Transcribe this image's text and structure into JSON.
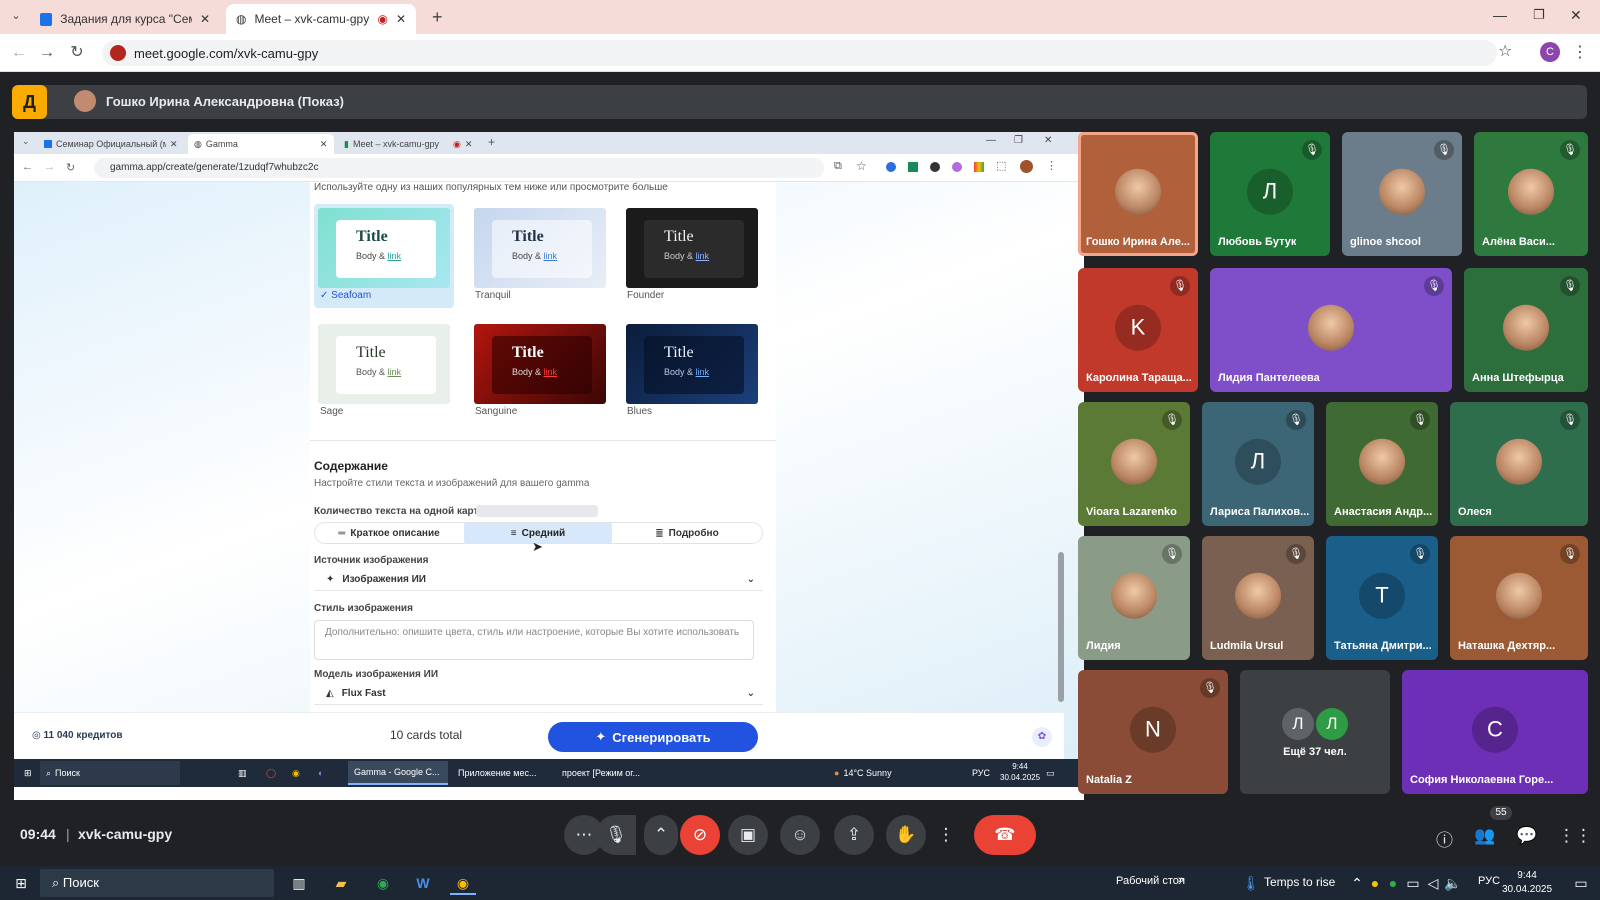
{
  "browser": {
    "tabs": [
      {
        "label": "Задания для курса \"Семинар"
      },
      {
        "label": "Meet – xvk-camu-gpy"
      }
    ],
    "url": "meet.google.com/xvk-camu-gpy"
  },
  "meet": {
    "presenter": "Гошко Ирина Александровна (Показ)",
    "logo": "Д",
    "time": "09:44",
    "code": "xvk-camu-gpy",
    "people_count": "55",
    "participants": [
      {
        "name": "Гошко Ирина Але...",
        "initial": "",
        "color": "#b0603a"
      },
      {
        "name": "Любовь Бутук",
        "initial": "Л",
        "color": "#1f7a39"
      },
      {
        "name": "glinoe shcool",
        "initial": "",
        "color": "#6b7d8a"
      },
      {
        "name": "Алёна Васи...",
        "initial": "",
        "color": "#2e7a3e"
      },
      {
        "name": "Каролина Тараща...",
        "initial": "K",
        "color": "#c0392b"
      },
      {
        "name": "Лидия Пантелеева",
        "initial": "",
        "color": "#7e4fc9"
      },
      {
        "name": "Анна Штефырца",
        "initial": "",
        "color": "#2c6e3c"
      },
      {
        "name": "Vioara Lazarenko",
        "initial": "",
        "color": "#5b7a36"
      },
      {
        "name": "Лариса Палихов...",
        "initial": "Л",
        "color": "#3c6575"
      },
      {
        "name": "Анастасия Андр...",
        "initial": "",
        "color": "#3f6a34"
      },
      {
        "name": "Олеся",
        "initial": "",
        "color": "#2f6e4c"
      },
      {
        "name": "Лидия",
        "initial": "",
        "color": "#8a9c88"
      },
      {
        "name": "Ludmila Ursul",
        "initial": "",
        "color": "#7a6050"
      },
      {
        "name": "Татьяна Дмитри...",
        "initial": "T",
        "color": "#1a5e8a"
      },
      {
        "name": "Наташка Дехтяр...",
        "initial": "",
        "color": "#9b5a33"
      },
      {
        "name": "Natalia Z",
        "initial": "N",
        "color": "#8a4c36"
      },
      {
        "name": "Ещё 37 чел.",
        "initial": "",
        "color": "#3c4043"
      },
      {
        "name": "София Николаевна Горе...",
        "initial": "C",
        "color": "#6d2fb5"
      }
    ],
    "more_initials": [
      "Л",
      "Л"
    ]
  },
  "shared": {
    "tabs": [
      {
        "label": "Семинар Официальный (мол..."
      },
      {
        "label": "Gamma"
      },
      {
        "label": "Meet – xvk-camu-gpy"
      }
    ],
    "url": "gamma.app/create/generate/1zudqf7whubzc2c",
    "intro": "Используйте одну из наших популярных тем ниже или просмотрите больше",
    "card_title": "Title",
    "card_body": "Body &",
    "card_link": "link",
    "themes": [
      {
        "name": "Seafoam"
      },
      {
        "name": "Tranquil"
      },
      {
        "name": "Founder"
      },
      {
        "name": "Sage"
      },
      {
        "name": "Sanguine"
      },
      {
        "name": "Blues"
      }
    ],
    "content_title": "Содержание",
    "content_sub": "Настройте стили текста и изображений для вашего gamma",
    "text_amount_label": "Количество текста на одной карте",
    "text_options": [
      "Краткое описание",
      "Средний",
      "Подробно"
    ],
    "image_source_label": "Источник изображения",
    "image_source_value": "Изображения ИИ",
    "image_style_label": "Стиль изображения",
    "image_style_placeholder": "Дополнительно: опишите цвета, стиль или настроение, которые Вы хотите использовать",
    "model_label": "Модель изображения ИИ",
    "model_value": "Flux Fast",
    "credits": "11 040 кредитов",
    "cards_total": "10 cards total",
    "generate": "Сгенерировать",
    "taskbar": {
      "search": "Поиск",
      "items": [
        "Gamma - Google C...",
        "Приложение мес...",
        "проект [Режим ог..."
      ],
      "weather": "14°C Sunny",
      "lang": "РУС",
      "time": "9:44",
      "date": "30.04.2025"
    }
  },
  "taskbar": {
    "search": "Поиск",
    "desktop": "Рабочий стол",
    "weather": "Temps to rise",
    "lang": "РУС",
    "time": "9:44",
    "date": "30.04.2025"
  },
  "colors": {
    "generate_button": "#2152e0",
    "hangup": "#ea4335",
    "camera_off": "#ea4335",
    "accent_orange": "#f9ab00"
  }
}
